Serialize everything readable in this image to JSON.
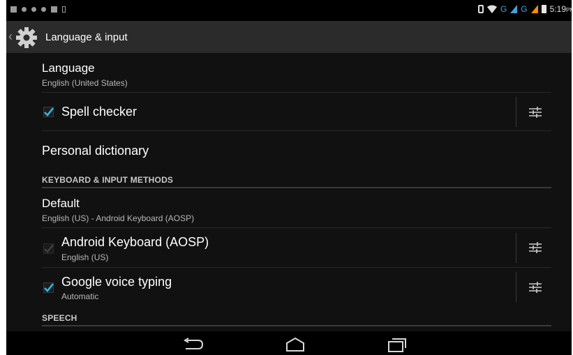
{
  "status_bar": {
    "left_icons": [
      "notification-icon",
      "usb-icon",
      "usb-debug-icon",
      "lock-icon",
      "notification-icon",
      "sd-card-icon"
    ],
    "time": "5:19",
    "time_suffix": "PM",
    "network_g1": "G",
    "network_g2": "G"
  },
  "action_bar": {
    "title": "Language & input",
    "icon": "settings-gear-icon"
  },
  "items": [
    {
      "title": "Language",
      "subtitle": "English (United States)"
    },
    {
      "title": "Spell checker",
      "checked": true
    },
    {
      "title": "Personal dictionary"
    }
  ],
  "sections": {
    "keyboard": "KEYBOARD & INPUT METHODS",
    "speech": "SPEECH"
  },
  "keyboard_items": [
    {
      "title": "Default",
      "subtitle": "English (US) - Android Keyboard (AOSP)"
    },
    {
      "title": "Android Keyboard (AOSP)",
      "subtitle": "English (US)",
      "checked": true,
      "disabled": true
    },
    {
      "title": "Google voice typing",
      "subtitle": "Automatic",
      "checked": true
    }
  ],
  "colors": {
    "accent": "#33b5e5",
    "background": "#111111",
    "action_bar": "#2b2b2b"
  },
  "nav_bar": [
    "back-icon",
    "home-icon",
    "recents-icon"
  ]
}
